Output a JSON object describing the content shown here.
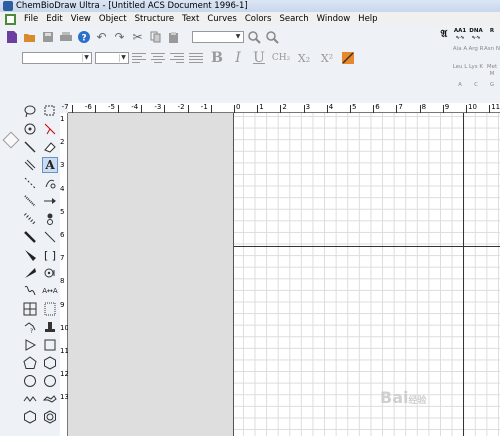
{
  "window": {
    "title": "ChemBioDraw Ultra - [Untitled ACS Document 1996-1]"
  },
  "menu": {
    "items": [
      "File",
      "Edit",
      "View",
      "Object",
      "Structure",
      "Text",
      "Curves",
      "Colors",
      "Search",
      "Window",
      "Help"
    ]
  },
  "toolbar1": {
    "icons": [
      "new-document-icon",
      "open-icon",
      "save-icon",
      "print-icon",
      "help-icon",
      "undo-icon",
      "redo-icon",
      "cut-icon",
      "copy-icon",
      "paste-icon",
      "zoom-select-icon",
      "zoom-in-icon",
      "zoom-out-icon"
    ],
    "zoom_value": ""
  },
  "toolbar2": {
    "font_value": "",
    "size_value": "",
    "subscript_ch2": "CH₂",
    "subscript_x2": "X₂",
    "superscript_x2": "X²"
  },
  "biopanel": {
    "row1": [
      "",
      "AA1",
      "DNA",
      "R"
    ],
    "row2": [
      "",
      "Ala A",
      "Arg R",
      "Asn N"
    ],
    "row3": [
      "",
      "Leu L",
      "Lys K",
      "Met M"
    ],
    "row4": [
      "",
      "A",
      "C",
      "G"
    ]
  },
  "ruler": {
    "top": [
      "-7",
      "-6",
      "-5",
      "-4",
      "-3",
      "-2",
      "-1",
      "0",
      "1",
      "2",
      "3",
      "4",
      "5",
      "6",
      "7",
      "8",
      "9",
      "10",
      "11"
    ],
    "left": [
      "1",
      "2",
      "3",
      "4",
      "5",
      "6",
      "7",
      "8",
      "9",
      "10",
      "11",
      "12",
      "13"
    ]
  },
  "watermark": {
    "text": "Bai",
    "suffix": "经验"
  }
}
